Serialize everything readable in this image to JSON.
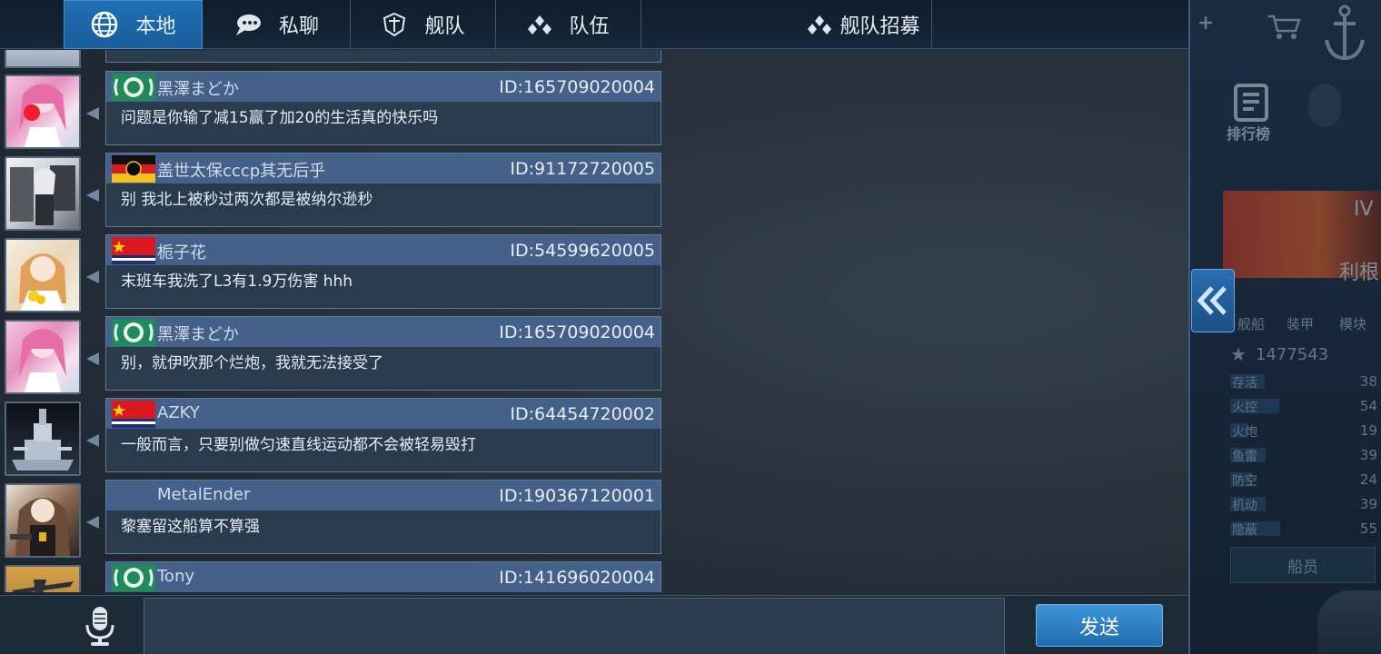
{
  "tabs": [
    {
      "label": "本地",
      "icon": "globe-icon",
      "active": true
    },
    {
      "label": "私聊",
      "icon": "chat-bubble-icon",
      "active": false
    },
    {
      "label": "舰队",
      "icon": "fleet-shield-icon",
      "active": false
    },
    {
      "label": "队伍",
      "icon": "team-dots-icon",
      "active": false
    },
    {
      "label": "舰队招募",
      "icon": "recruit-dots-icon",
      "active": false
    }
  ],
  "messages": [
    {
      "name": "黑澤まどか",
      "id": "ID:165709020004",
      "text": "问题是你输了减15赢了加20的生活真的快乐吗",
      "flag": "green-emblem",
      "avatar": "pink-hair-girl"
    },
    {
      "name": "盖世太保cccp其无后乎",
      "id": "ID:91172720005",
      "text": "别 我北上被秒过两次都是被纳尔逊秒",
      "flag": "germany",
      "avatar": "white-hair-rigging-girl"
    },
    {
      "name": "栀子花",
      "id": "ID:54599620005",
      "text": "末班车我洗了L3有1.9万伤害 hhh",
      "flag": "china-navy",
      "avatar": "blonde-bride"
    },
    {
      "name": "黑澤まどか",
      "id": "ID:165709020004",
      "text": "别，就伊吹那个烂炮，我就无法接受了",
      "flag": "green-emblem",
      "avatar": "pink-hair-girl"
    },
    {
      "name": "AZKY",
      "id": "ID:64454720002",
      "text": "一般而言，只要别做匀速直线运动都不会被轻易毁打",
      "flag": "china-navy",
      "avatar": "battleship"
    },
    {
      "name": "MetalEnder",
      "id": "ID:190367120001",
      "text": "黎塞留这船算不算强",
      "flag": "none",
      "avatar": "gunner-girl"
    },
    {
      "name": "Tony",
      "id": "ID:141696020004",
      "text": "",
      "flag": "green-emblem",
      "avatar": "aircraft"
    }
  ],
  "input": {
    "value": "",
    "placeholder": ""
  },
  "send_label": "发送",
  "panel": {
    "rank_label": "排行榜",
    "tier": "IV",
    "ship_name": "利根",
    "menu": [
      "舰船",
      "装甲",
      "模块"
    ],
    "rating": "1477543",
    "stats": [
      {
        "label": "存活",
        "value": "38",
        "fill": 0.38
      },
      {
        "label": "火控",
        "value": "54",
        "fill": 0.54
      },
      {
        "label": "火炮",
        "value": "19",
        "fill": 0.19
      },
      {
        "label": "鱼雷",
        "value": "39",
        "fill": 0.39
      },
      {
        "label": "防空",
        "value": "24",
        "fill": 0.24
      },
      {
        "label": "机动",
        "value": "39",
        "fill": 0.39
      },
      {
        "label": "隐蔽",
        "value": "55",
        "fill": 0.55
      }
    ],
    "crew_label": "船员"
  },
  "colors": {
    "accent": "#1f6fb6",
    "header": "#45618a",
    "bubble": "#2a3b4e"
  }
}
